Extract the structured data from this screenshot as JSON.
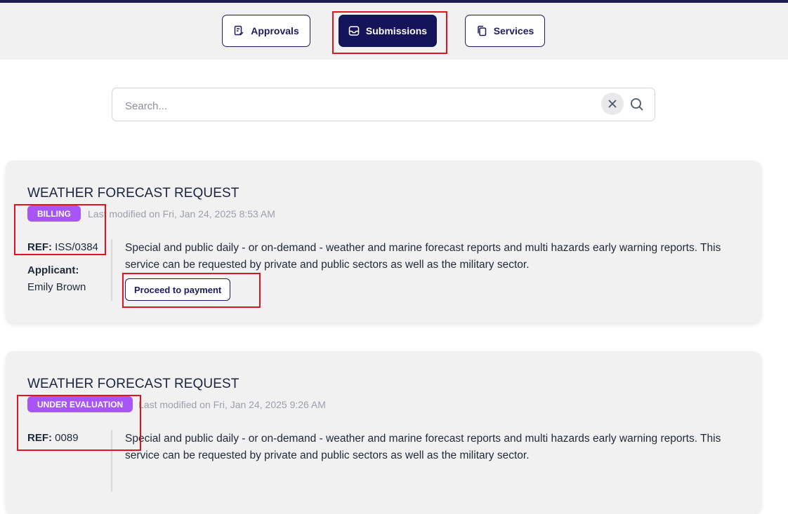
{
  "tabs": [
    {
      "label": "Approvals",
      "icon": "approvals-icon",
      "active": false
    },
    {
      "label": "Submissions",
      "icon": "inbox-icon",
      "active": true
    },
    {
      "label": "Services",
      "icon": "copy-icon",
      "active": false
    }
  ],
  "search": {
    "placeholder": "Search...",
    "value": ""
  },
  "cards": [
    {
      "title": "WEATHER FORECAST REQUEST",
      "status": "BILLING",
      "status_color": "#a855f7",
      "modified": "Last modified on Fri, Jan 24, 2025 8:53 AM",
      "ref_label": "REF:",
      "ref_value": "ISS/0384",
      "applicant_label": "Applicant:",
      "applicant_name": "Emily Brown",
      "description": "Special and public daily - or on-demand - weather and marine forecast reports and multi hazards early warning reports. This service can be requested by private and public sectors as well as the military sector.",
      "action_label": "Proceed to payment"
    },
    {
      "title": "WEATHER FORECAST REQUEST",
      "status": "UNDER EVALUATION",
      "status_color": "#a855f7",
      "modified": "Last modified on Fri, Jan 24, 2025 9:26 AM",
      "ref_label": "REF:",
      "ref_value": "0089",
      "description": "Special and public daily - or on-demand - weather and marine forecast reports and multi hazards early warning reports. This service can be requested by private and public sectors as well as the military sector."
    }
  ],
  "colors": {
    "primary": "#15135a",
    "badge": "#a855f7",
    "highlight": "#e0141e"
  }
}
